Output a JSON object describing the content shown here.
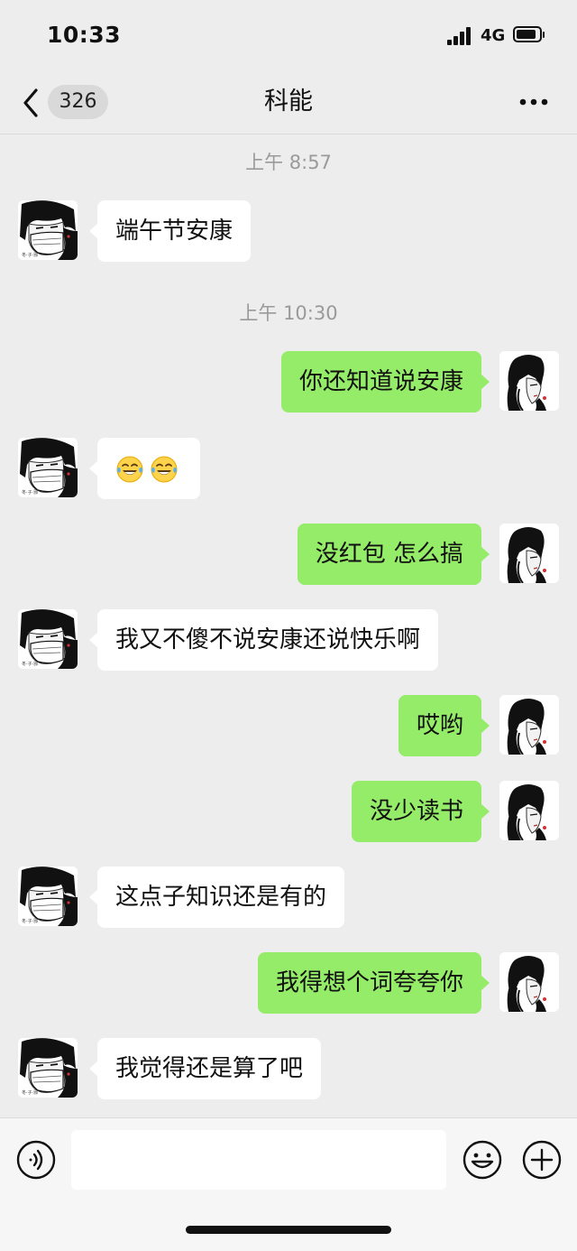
{
  "status_bar": {
    "time": "10:33",
    "network": "4G"
  },
  "header": {
    "unread_count": "326",
    "title": "科能"
  },
  "messages": [
    {
      "timestamp": "上午 8:57"
    },
    {
      "from": "contact",
      "text": "端午节安康"
    },
    {
      "timestamp": "上午 10:30"
    },
    {
      "from": "me",
      "text": "你还知道说安康"
    },
    {
      "from": "contact",
      "emoji": [
        "face-with-tears-of-joy",
        "face-with-tears-of-joy"
      ]
    },
    {
      "from": "me",
      "text": "没红包 怎么搞"
    },
    {
      "from": "contact",
      "text": "我又不傻不说安康还说快乐啊"
    },
    {
      "from": "me",
      "text": "哎哟"
    },
    {
      "from": "me",
      "text": "没少读书"
    },
    {
      "from": "contact",
      "text": "这点子知识还是有的"
    },
    {
      "from": "me",
      "text": "我得想个词夸夸你"
    },
    {
      "from": "contact",
      "text": "我觉得还是算了吧"
    }
  ],
  "input_bar": {
    "value": ""
  },
  "icons": {
    "back": "chevron-left-icon",
    "more": "more-dots-icon",
    "voice": "voice-icon",
    "emoji_panel": "smiley-icon",
    "attach": "plus-circle-icon"
  },
  "colors": {
    "background": "#ededed",
    "incoming_bubble": "#ffffff",
    "outgoing_bubble": "#95ec69",
    "timestamp": "#9a9a9a"
  }
}
